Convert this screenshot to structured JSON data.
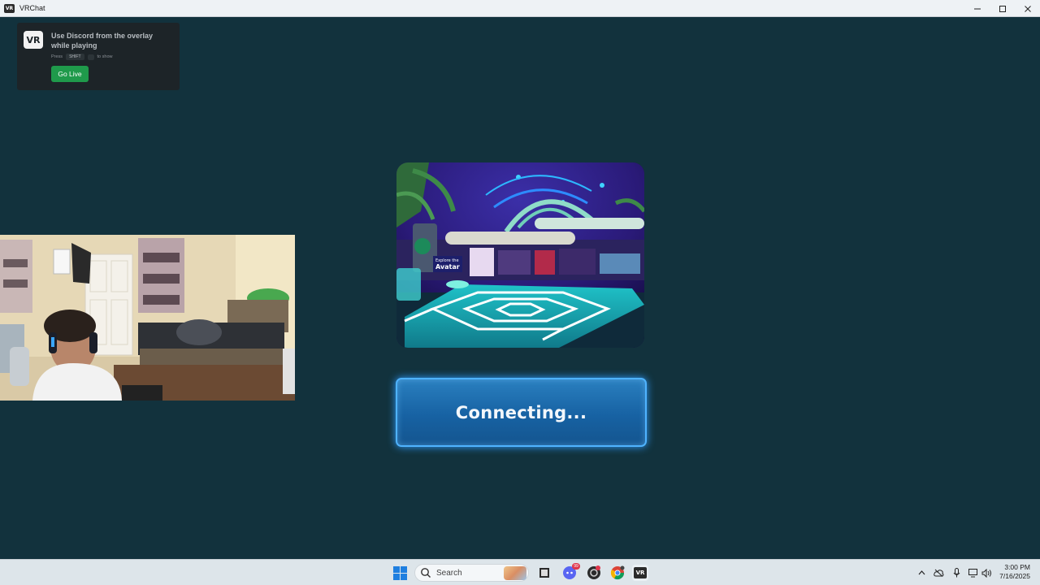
{
  "window": {
    "title": "VRChat",
    "app_icon_text": "VR"
  },
  "overlay": {
    "logo_text": "VR",
    "message": "Use Discord from the overlay while playing",
    "hint_press": "Press",
    "hint_key": "SHIFT",
    "hint_action": "to show",
    "go_live_label": "Go Live"
  },
  "world_preview": {
    "sign_line1": "Explore the",
    "sign_line2": "Avatar"
  },
  "status": {
    "connecting_label": "Connecting..."
  },
  "taskbar": {
    "search_placeholder": "Search",
    "discord_badge": "99",
    "time": "3:00 PM",
    "date": "7/16/2025",
    "vrchat_label": "VR"
  },
  "colors": {
    "background": "#12323d",
    "go_live": "#1f9a4b",
    "connect_button": "#1762a3",
    "connect_glow": "#4fb3ff"
  }
}
